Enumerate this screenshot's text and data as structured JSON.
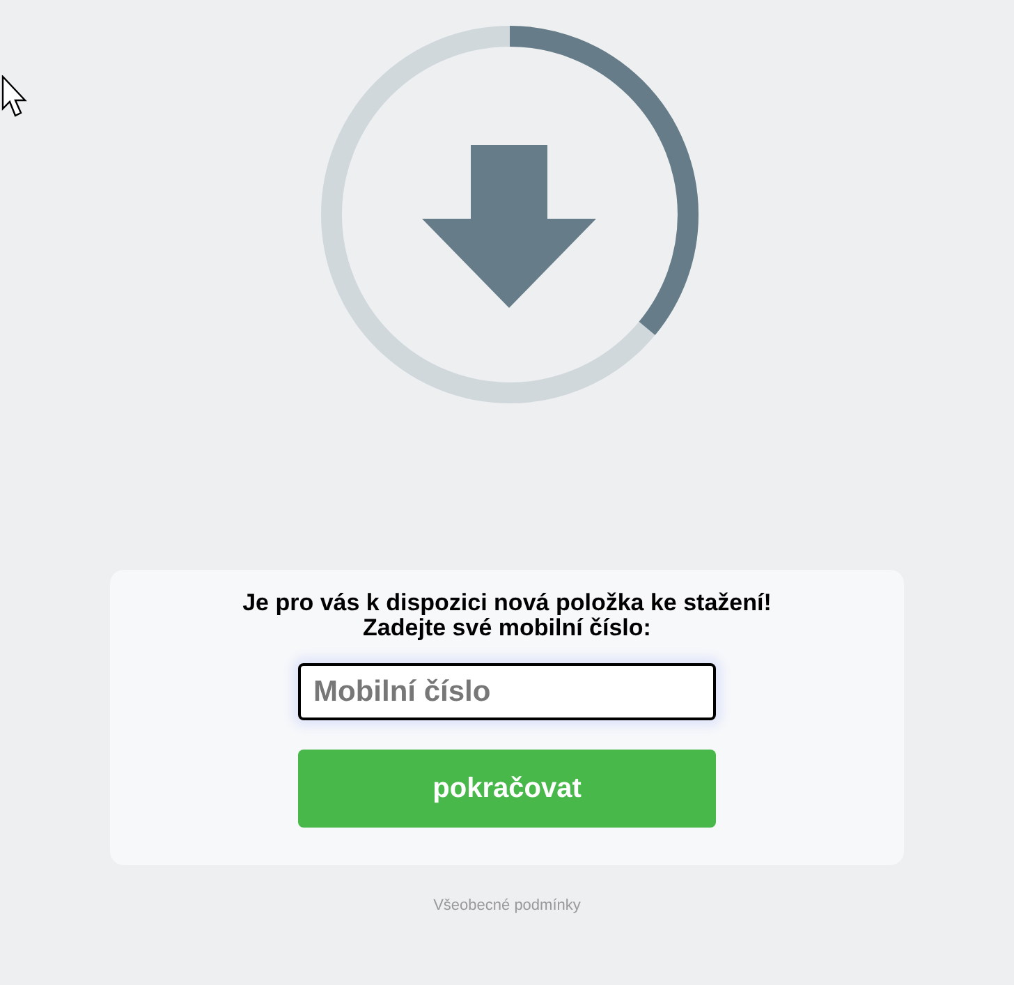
{
  "download": {
    "level": 0.36
  },
  "card": {
    "title_lines": [
      "Je pro vás k dispozici nová položka ke stažení!",
      "Zadejte své mobilní číslo:"
    ],
    "phone_field": {
      "placeholder": "Mobilní číslo"
    },
    "button": "pokračovat"
  },
  "footer_link": "Všeobecné podmínky"
}
